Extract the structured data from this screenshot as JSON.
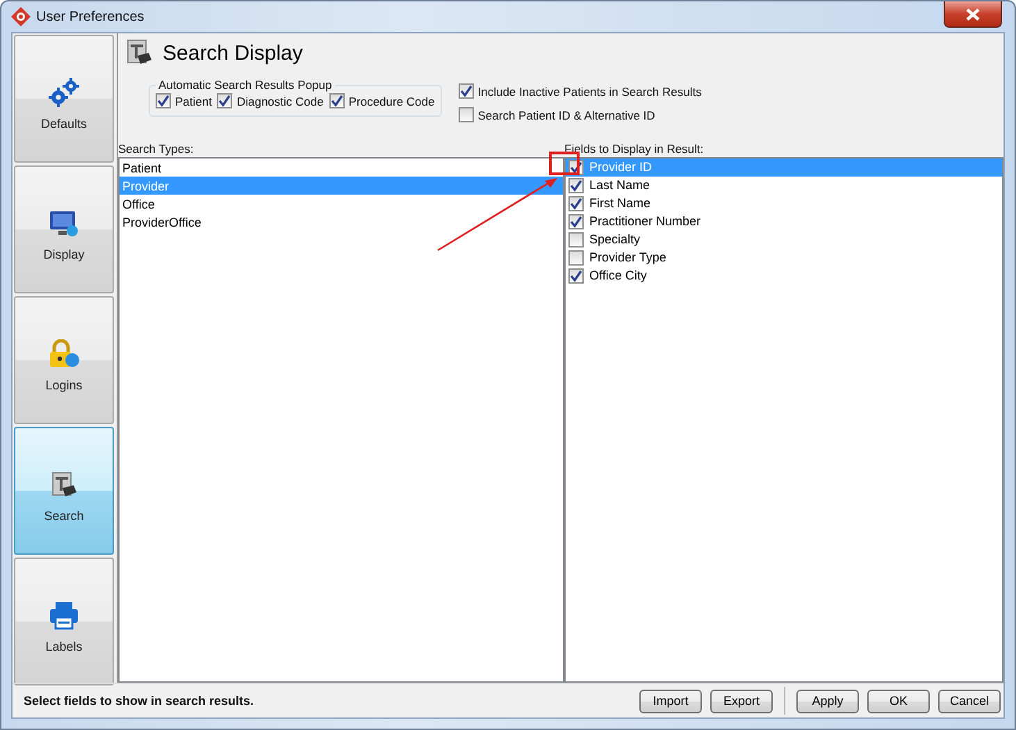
{
  "window": {
    "title": "User Preferences"
  },
  "sidebar": {
    "items": [
      {
        "label": "Defaults",
        "selected": false
      },
      {
        "label": "Display",
        "selected": false
      },
      {
        "label": "Logins",
        "selected": false
      },
      {
        "label": "Search",
        "selected": true
      },
      {
        "label": "Labels",
        "selected": false
      }
    ]
  },
  "page": {
    "title": "Search Display"
  },
  "popup_group": {
    "title": "Automatic Search Results Popup",
    "options": [
      {
        "label": "Patient",
        "checked": true
      },
      {
        "label": "Diagnostic Code",
        "checked": true
      },
      {
        "label": "Procedure Code",
        "checked": true
      }
    ]
  },
  "options": [
    {
      "label": "Include Inactive Patients in Search Results",
      "checked": true
    },
    {
      "label": "Search Patient ID & Alternative ID",
      "checked": false
    }
  ],
  "search_types": {
    "label": "Search Types:",
    "items": [
      {
        "label": "Patient",
        "selected": false
      },
      {
        "label": "Provider",
        "selected": true
      },
      {
        "label": "Office",
        "selected": false
      },
      {
        "label": "ProviderOffice",
        "selected": false
      }
    ]
  },
  "fields": {
    "label": "Fields to Display in Result:",
    "items": [
      {
        "label": "Provider ID",
        "checked": true,
        "selected": true
      },
      {
        "label": "Last Name",
        "checked": true,
        "selected": false
      },
      {
        "label": "First Name",
        "checked": true,
        "selected": false
      },
      {
        "label": "Practitioner Number",
        "checked": true,
        "selected": false
      },
      {
        "label": "Specialty",
        "checked": false,
        "selected": false
      },
      {
        "label": "Provider Type",
        "checked": false,
        "selected": false
      },
      {
        "label": "Office City",
        "checked": true,
        "selected": false
      }
    ]
  },
  "status_bar": {
    "text": "Select fields to show in search results."
  },
  "file_buttons": [
    "Import",
    "Export"
  ],
  "dialog_buttons": [
    "Apply",
    "OK",
    "Cancel"
  ]
}
